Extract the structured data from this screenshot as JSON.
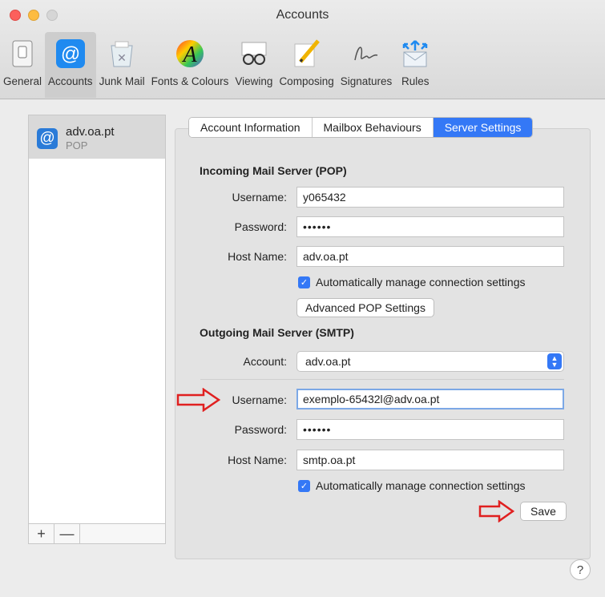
{
  "window": {
    "title": "Accounts"
  },
  "toolbar": {
    "items": [
      {
        "label": "General",
        "icon": "general-switch-icon"
      },
      {
        "label": "Accounts",
        "icon": "at-sign-icon"
      },
      {
        "label": "Junk Mail",
        "icon": "junk-mail-bin-icon"
      },
      {
        "label": "Fonts & Colours",
        "icon": "fonts-colours-icon"
      },
      {
        "label": "Viewing",
        "icon": "glasses-icon"
      },
      {
        "label": "Composing",
        "icon": "pencil-icon"
      },
      {
        "label": "Signatures",
        "icon": "signature-icon"
      },
      {
        "label": "Rules",
        "icon": "rules-envelope-icon"
      }
    ],
    "active": "Accounts"
  },
  "accounts": {
    "list": [
      {
        "name": "adv.oa.pt",
        "type": "POP"
      }
    ],
    "add_label": "+",
    "remove_label": "—"
  },
  "tabs": {
    "items": [
      "Account Information",
      "Mailbox Behaviours",
      "Server Settings"
    ],
    "selected": "Server Settings"
  },
  "incoming": {
    "title": "Incoming Mail Server (POP)",
    "username_label": "Username:",
    "username": "y065432",
    "password_label": "Password:",
    "password": "••••••",
    "host_label": "Host Name:",
    "host": "adv.oa.pt",
    "auto_manage_label": "Automatically manage connection settings",
    "advanced_button": "Advanced POP Settings"
  },
  "outgoing": {
    "title": "Outgoing Mail Server (SMTP)",
    "account_label": "Account:",
    "account": "adv.oa.pt",
    "username_label": "Username:",
    "username": "exemplo-65432l@adv.oa.pt",
    "password_label": "Password:",
    "password": "••••••",
    "host_label": "Host Name:",
    "host": "smtp.oa.pt",
    "auto_manage_label": "Automatically manage connection settings"
  },
  "save_label": "Save",
  "help_label": "?",
  "colors": {
    "accent": "#3478f6",
    "annotation_arrow": "#e02020"
  }
}
